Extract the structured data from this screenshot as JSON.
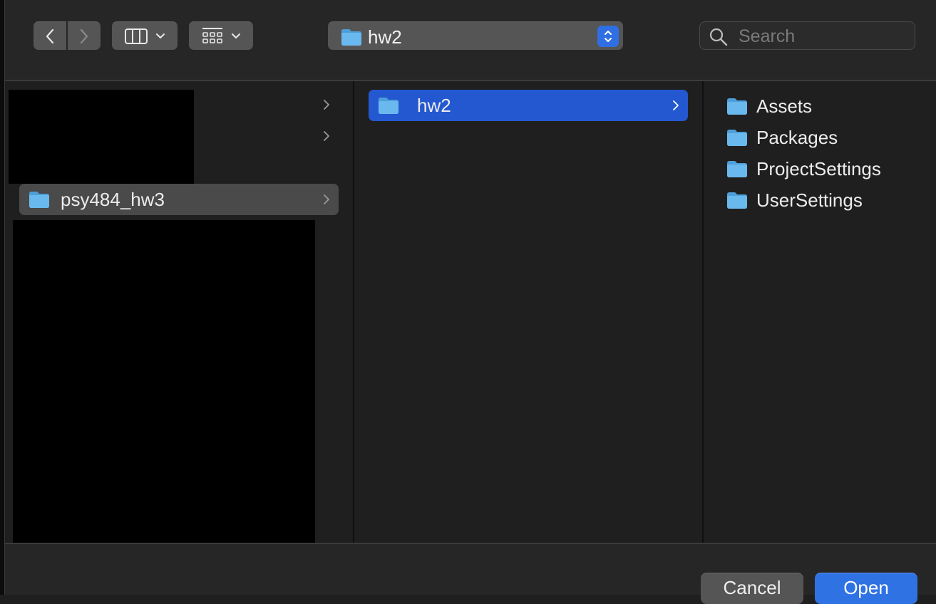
{
  "toolbar": {
    "current_folder": "hw2",
    "search_placeholder": "Search"
  },
  "columns": {
    "left": {
      "items": [
        {
          "label": "",
          "redacted": true,
          "has_children": true
        },
        {
          "label": "",
          "redacted": true,
          "has_children": true
        },
        {
          "label": "psy484_hw3",
          "selected": true,
          "has_children": true
        }
      ]
    },
    "middle": {
      "items": [
        {
          "label": "hw2",
          "selected": true,
          "has_children": true
        }
      ]
    },
    "right": {
      "items": [
        {
          "label": "Assets"
        },
        {
          "label": "Packages"
        },
        {
          "label": "ProjectSettings"
        },
        {
          "label": "UserSettings"
        }
      ]
    }
  },
  "footer": {
    "cancel_label": "Cancel",
    "open_label": "Open"
  },
  "colors": {
    "accent": "#2f72e4",
    "selection_blue": "#2458d1",
    "selection_gray": "#4a4a4a",
    "folder_icon": "#5fb0ea"
  }
}
